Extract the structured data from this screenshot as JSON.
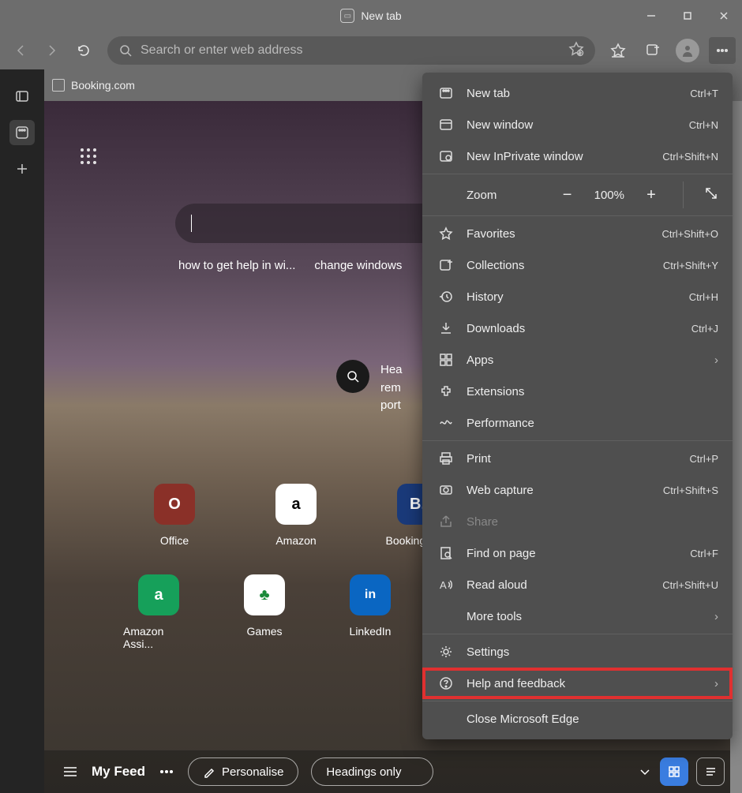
{
  "window": {
    "title": "New tab"
  },
  "toolbar": {
    "omnibox_placeholder": "Search or enter web address"
  },
  "tab": {
    "label": "Booking.com"
  },
  "suggestions": [
    "how to get help in wi...",
    "change windows"
  ],
  "news": {
    "line1": "Hea",
    "line2": "rem",
    "line3": "port"
  },
  "tiles_row1": [
    {
      "label": "Office",
      "bg": "#8a3028",
      "fg": "#fff",
      "char": "O"
    },
    {
      "label": "Amazon",
      "bg": "#ffffff",
      "fg": "#000",
      "char": "a"
    },
    {
      "label": "Booking.com",
      "bg": "#1a3a7a",
      "fg": "#fff",
      "char": "B."
    }
  ],
  "tiles_row2": [
    {
      "label": "Amazon Assi...",
      "bg": "#16a05a",
      "fg": "#fff",
      "char": "a"
    },
    {
      "label": "Games",
      "bg": "#ffffff",
      "fg": "#1a8a3a",
      "char": "♣"
    },
    {
      "label": "LinkedIn",
      "bg": "#0a66c2",
      "fg": "#fff",
      "char": "in"
    }
  ],
  "feed": {
    "label": "My Feed",
    "personalise": "Personalise",
    "headings": "Headings only"
  },
  "menu": {
    "new_tab": {
      "label": "New tab",
      "shortcut": "Ctrl+T"
    },
    "new_window": {
      "label": "New window",
      "shortcut": "Ctrl+N"
    },
    "new_inprivate": {
      "label": "New InPrivate window",
      "shortcut": "Ctrl+Shift+N"
    },
    "zoom": {
      "label": "Zoom",
      "value": "100%"
    },
    "favorites": {
      "label": "Favorites",
      "shortcut": "Ctrl+Shift+O"
    },
    "collections": {
      "label": "Collections",
      "shortcut": "Ctrl+Shift+Y"
    },
    "history": {
      "label": "History",
      "shortcut": "Ctrl+H"
    },
    "downloads": {
      "label": "Downloads",
      "shortcut": "Ctrl+J"
    },
    "apps": {
      "label": "Apps"
    },
    "extensions": {
      "label": "Extensions"
    },
    "performance": {
      "label": "Performance"
    },
    "print": {
      "label": "Print",
      "shortcut": "Ctrl+P"
    },
    "web_capture": {
      "label": "Web capture",
      "shortcut": "Ctrl+Shift+S"
    },
    "share": {
      "label": "Share"
    },
    "find": {
      "label": "Find on page",
      "shortcut": "Ctrl+F"
    },
    "read_aloud": {
      "label": "Read aloud",
      "shortcut": "Ctrl+Shift+U"
    },
    "more_tools": {
      "label": "More tools"
    },
    "settings": {
      "label": "Settings"
    },
    "help": {
      "label": "Help and feedback"
    },
    "close_edge": {
      "label": "Close Microsoft Edge"
    }
  }
}
